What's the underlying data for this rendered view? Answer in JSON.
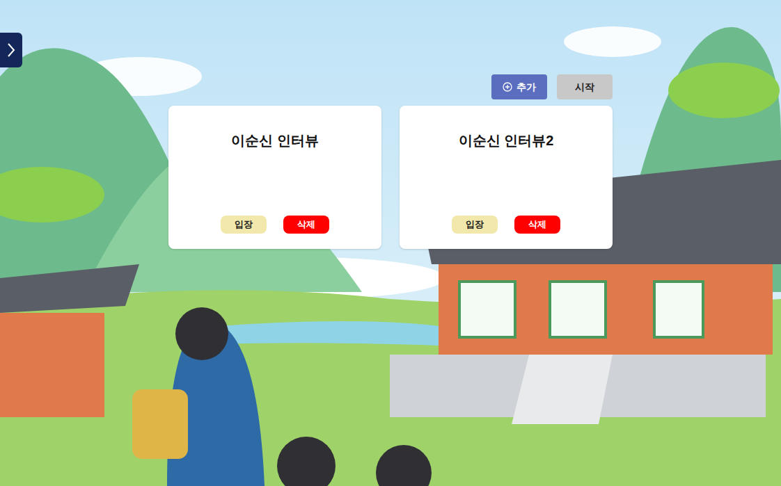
{
  "toolbar": {
    "buttons": [
      {
        "label": "추가",
        "kind": "add"
      },
      {
        "label": "시작",
        "kind": "start"
      }
    ]
  },
  "rooms": [
    {
      "title": "이순신 인터뷰",
      "enter": "입장",
      "delete": "삭제"
    },
    {
      "title": "이순신 인터뷰2",
      "enter": "입장",
      "delete": "삭제"
    }
  ]
}
